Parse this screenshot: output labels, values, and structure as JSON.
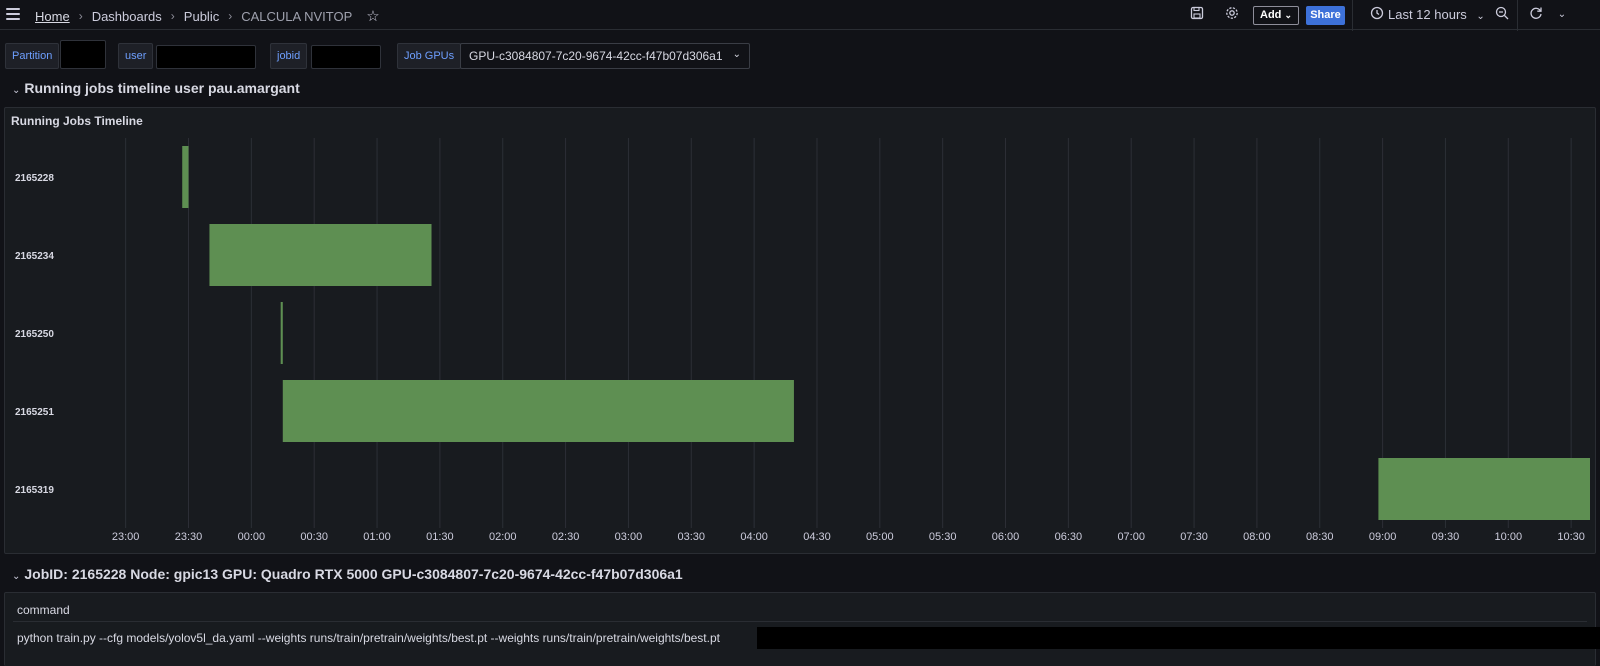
{
  "breadcrumb": {
    "home": "Home",
    "dashboards": "Dashboards",
    "public": "Public",
    "current": "CALCULA NVITOP"
  },
  "toolbar": {
    "add_label": "Add",
    "share_label": "Share",
    "time_range": "Last 12 hours"
  },
  "variables": {
    "partition_label": "Partition",
    "user_label": "user",
    "jobid_label": "jobid",
    "job_gpus_label": "Job GPUs",
    "job_gpus_value": "GPU-c3084807-7c20-9674-42cc-f47b07d306a1"
  },
  "row1": {
    "title": "Running jobs timeline user pau.amargant"
  },
  "timeline_panel": {
    "title": "Running Jobs Timeline"
  },
  "chart_data": {
    "type": "timeline",
    "color": "#5e8f52",
    "x_ticks": [
      "23:00",
      "23:30",
      "00:00",
      "00:30",
      "01:00",
      "01:30",
      "02:00",
      "02:30",
      "03:00",
      "03:30",
      "04:00",
      "04:30",
      "05:00",
      "05:30",
      "06:00",
      "06:30",
      "07:00",
      "07:30",
      "08:00",
      "08:30",
      "09:00",
      "09:30",
      "10:00",
      "10:30"
    ],
    "xlim": [
      "22:32",
      "10:39"
    ],
    "jobs": [
      {
        "id": "2165228",
        "start": "23:27",
        "end": "23:30"
      },
      {
        "id": "2165234",
        "start": "23:40",
        "end": "01:26"
      },
      {
        "id": "2165250",
        "start": "00:14",
        "end": "00:15"
      },
      {
        "id": "2165251",
        "start": "00:15",
        "end": "04:19"
      },
      {
        "id": "2165319",
        "start": "08:58",
        "end": "10:39"
      }
    ]
  },
  "row2": {
    "title": "JobID: 2165228 Node: gpic13 GPU: Quadro RTX 5000 GPU-c3084807-7c20-9674-42cc-f47b07d306a1"
  },
  "command_table": {
    "header": "command",
    "value": "python train.py --cfg models/yolov5l_da.yaml --weights runs/train/pretrain/weights/best.pt --weights runs/train/pretrain/weights/best.pt"
  }
}
